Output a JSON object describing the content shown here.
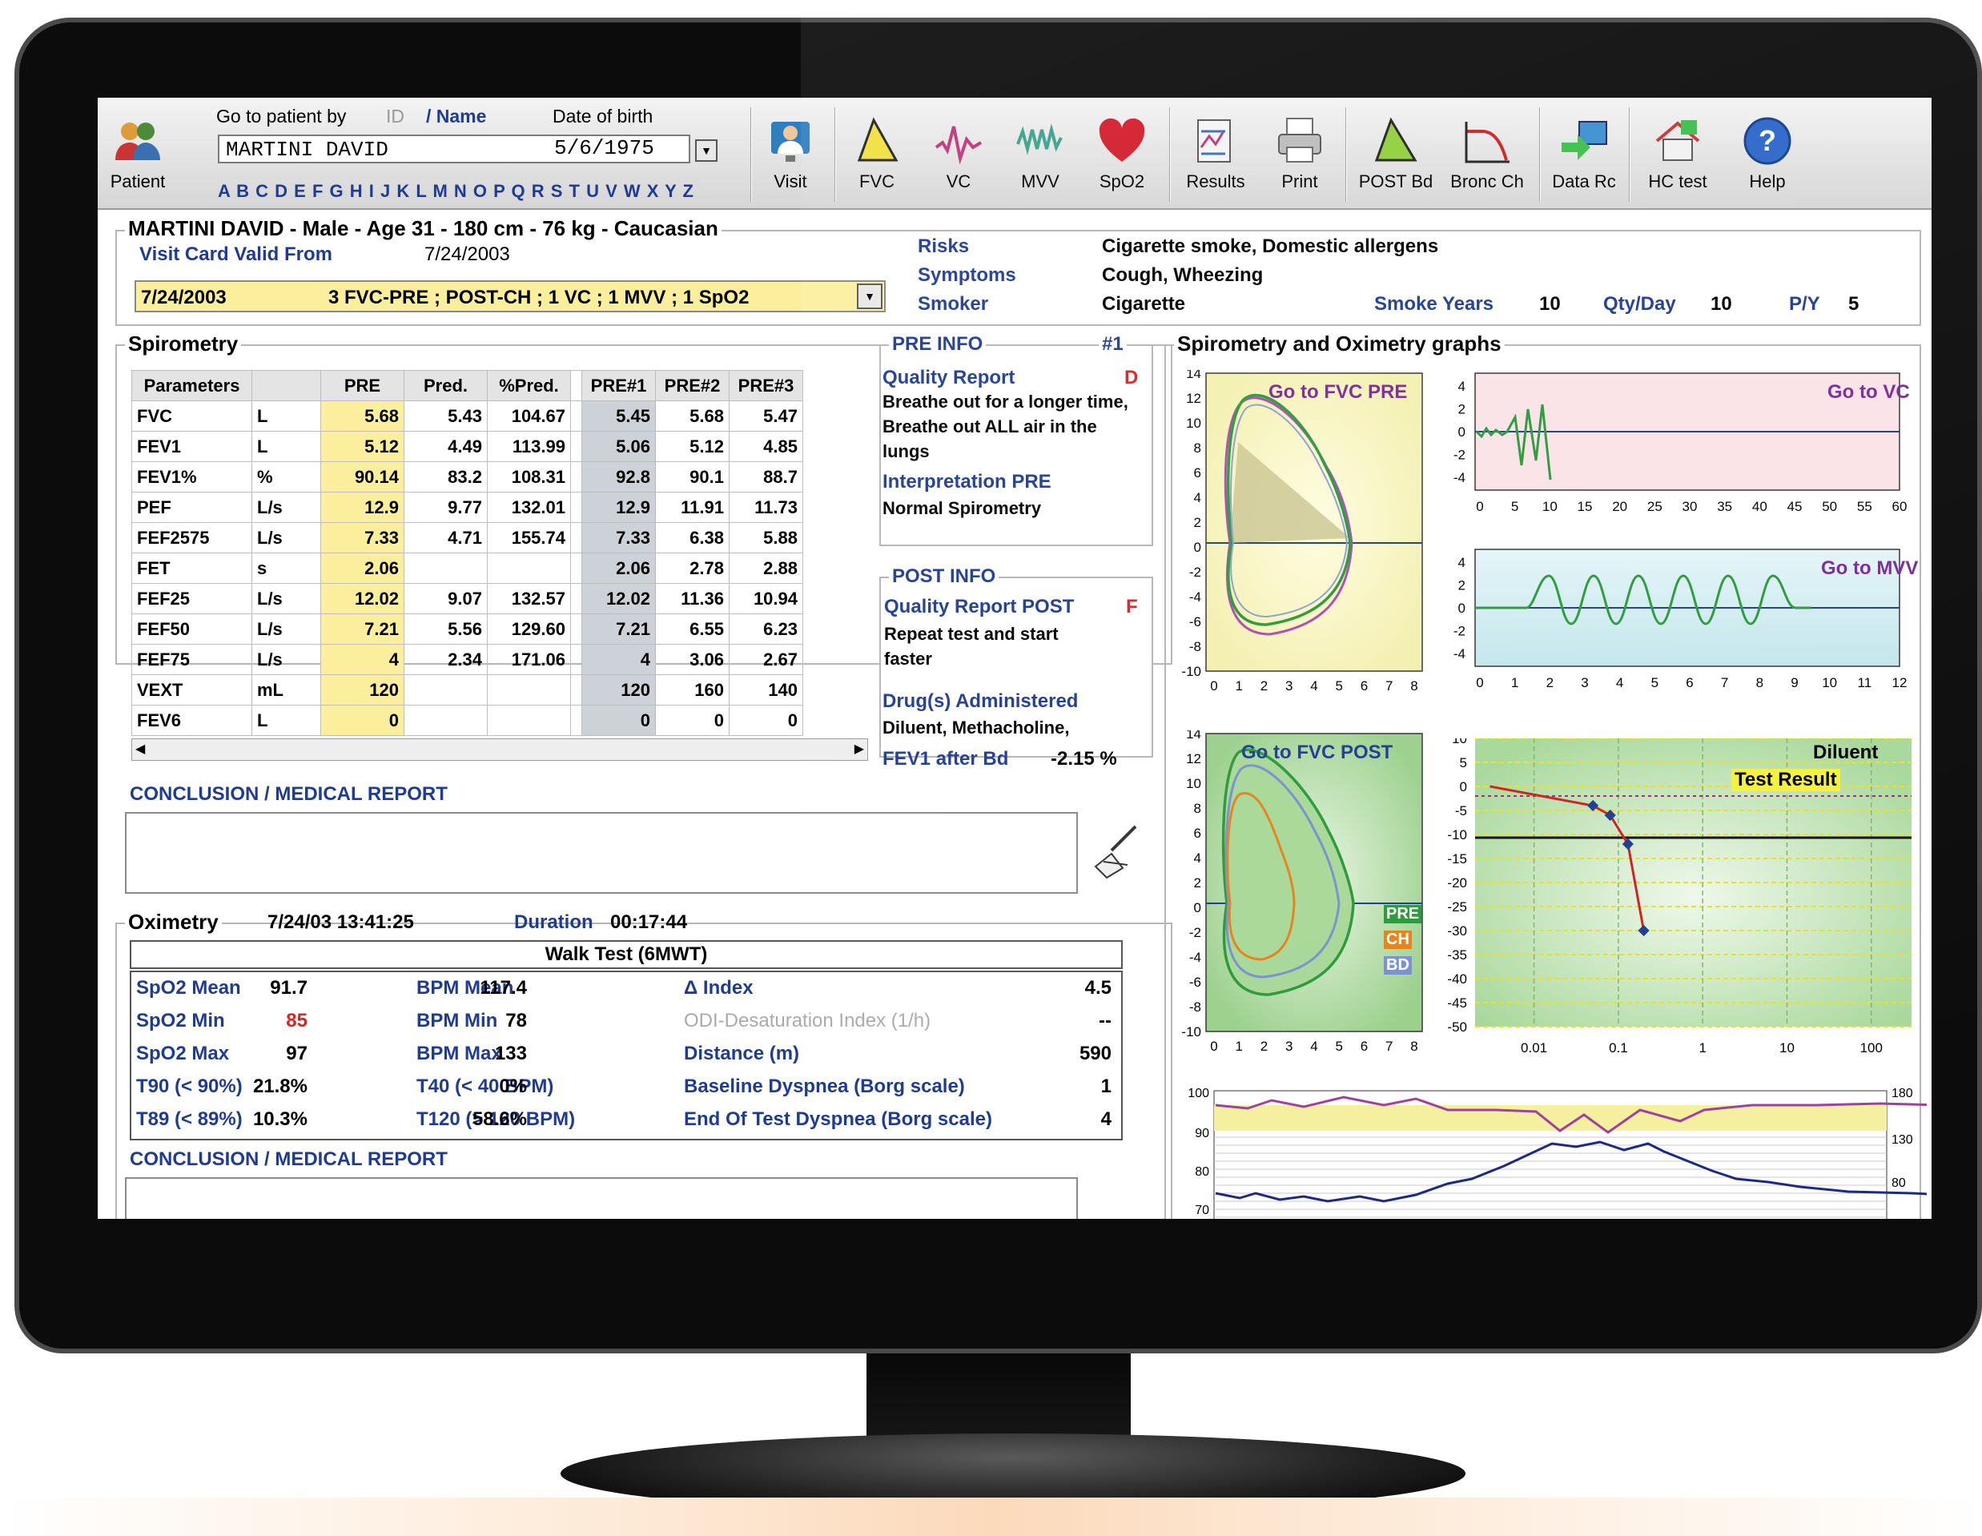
{
  "toolbar": {
    "patient_label": "Patient",
    "goto_label": "Go to patient by",
    "goto_id": "ID",
    "goto_name": "/ Name",
    "dob_label": "Date of birth",
    "patient_name": "MARTINI DAVID",
    "dob_value": "5/6/1975",
    "alphabet": "A B C D E F G H I J K L M N O P Q R S T U V W X Y Z",
    "buttons": [
      "Visit",
      "FVC",
      "VC",
      "MVV",
      "SpO2",
      "Results",
      "Print",
      "POST Bd",
      "Bronc Ch",
      "Data Rc",
      "HC test",
      "Help"
    ]
  },
  "patient": {
    "header": "MARTINI DAVID - Male - Age 31 - 180 cm - 76 kg - Caucasian",
    "visit_valid_label": "Visit Card Valid From",
    "visit_valid_date": "7/24/2003",
    "visit_select_date": "7/24/2003",
    "visit_select_tests": "3 FVC-PRE ; POST-CH ; 1 VC ; 1 MVV ; 1 SpO2",
    "risks_label": "Risks",
    "risks_value": "Cigarette smoke, Domestic allergens",
    "symptoms_label": "Symptoms",
    "symptoms_value": "Cough, Wheezing",
    "smoker_label": "Smoker",
    "smoker_value": "Cigarette",
    "smoke_years_label": "Smoke Years",
    "smoke_years_value": "10",
    "qty_label": "Qty/Day",
    "qty_value": "10",
    "py_label": "P/Y",
    "py_value": "5"
  },
  "spirometry": {
    "title": "Spirometry",
    "columns": [
      "Parameters",
      "",
      "PRE",
      "Pred.",
      "%Pred.",
      "",
      "PRE#1",
      "PRE#2",
      "PRE#3"
    ],
    "rows": [
      [
        "FVC",
        "L",
        "5.68",
        "5.43",
        "104.67",
        "5.45",
        "5.68",
        "5.47"
      ],
      [
        "FEV1",
        "L",
        "5.12",
        "4.49",
        "113.99",
        "5.06",
        "5.12",
        "4.85"
      ],
      [
        "FEV1%",
        "%",
        "90.14",
        "83.2",
        "108.31",
        "92.8",
        "90.1",
        "88.7"
      ],
      [
        "PEF",
        "L/s",
        "12.9",
        "9.77",
        "132.01",
        "12.9",
        "11.91",
        "11.73"
      ],
      [
        "FEF2575",
        "L/s",
        "7.33",
        "4.71",
        "155.74",
        "7.33",
        "6.38",
        "5.88"
      ],
      [
        "FET",
        "s",
        "2.06",
        "",
        "",
        "2.06",
        "2.78",
        "2.88"
      ],
      [
        "FEF25",
        "L/s",
        "12.02",
        "9.07",
        "132.57",
        "12.02",
        "11.36",
        "10.94"
      ],
      [
        "FEF50",
        "L/s",
        "7.21",
        "5.56",
        "129.60",
        "7.21",
        "6.55",
        "6.23"
      ],
      [
        "FEF75",
        "L/s",
        "4",
        "2.34",
        "171.06",
        "4",
        "3.06",
        "2.67"
      ],
      [
        "VEXT",
        "mL",
        "120",
        "",
        "",
        "120",
        "160",
        "140"
      ],
      [
        "FEV6",
        "L",
        "0",
        "",
        "",
        "0",
        "0",
        "0"
      ]
    ],
    "conclusion_label": "CONCLUSION / MEDICAL REPORT"
  },
  "pre_info": {
    "title": "PRE INFO",
    "number": "#1",
    "quality_label": "Quality Report",
    "quality_grade": "D",
    "quality_text": "Breathe out for a longer time, Breathe out ALL air in the lungs",
    "interp_label": "Interpretation PRE",
    "interp_text": "Normal Spirometry"
  },
  "post_info": {
    "title": "POST INFO",
    "quality_label": "Quality Report POST",
    "quality_grade": "F",
    "quality_text": "Repeat test and start faster",
    "drugs_label": "Drug(s) Administered",
    "drugs_text": "Diluent, Methacholine,",
    "fev1_label": "FEV1 after Bd",
    "fev1_value": "-2.15 %"
  },
  "oximetry": {
    "title": "Oximetry",
    "datetime": "7/24/03 13:41:25",
    "duration_label": "Duration",
    "duration_value": "00:17:44",
    "test_name": "Walk Test (6MWT)",
    "col1": [
      [
        "SpO2 Mean",
        "91.7"
      ],
      [
        "SpO2 Min",
        "85"
      ],
      [
        "SpO2 Max",
        "97"
      ],
      [
        "T90 (< 90%)",
        "21.8%"
      ],
      [
        "T89 (< 89%)",
        "10.3%"
      ]
    ],
    "col2": [
      [
        "BPM Mean",
        "117.4"
      ],
      [
        "BPM Min",
        "78"
      ],
      [
        "BPM Max",
        "133"
      ],
      [
        "T40 (< 40 BPM)",
        "0%"
      ],
      [
        "T120 (> 120 BPM)",
        "58.6%"
      ]
    ],
    "col3": [
      [
        "Δ Index",
        "4.5"
      ],
      [
        "ODI-Desaturation Index (1/h)",
        "--"
      ],
      [
        "Distance (m)",
        "590"
      ],
      [
        "Baseline Dyspnea (Borg scale)",
        "1"
      ],
      [
        "End Of Test Dyspnea (Borg scale)",
        "4"
      ]
    ],
    "conclusion_label": "CONCLUSION / MEDICAL REPORT"
  },
  "graphs": {
    "title": "Spirometry and Oximetry graphs",
    "fvc_pre_link": "Go to FVC PRE",
    "vc_link": "Go to VC",
    "mvv_link": "Go to MVV",
    "fvc_post_link": "Go to FVC POST",
    "legend_pre": "PRE",
    "legend_ch": "CH",
    "legend_bd": "BD",
    "bronc_label": "Diluent",
    "bronc_result": "Test Result"
  },
  "chart_data": [
    {
      "type": "line",
      "name": "FVC PRE flow-volume",
      "x_ticks": [
        "0",
        "1",
        "2",
        "3",
        "4",
        "5",
        "6",
        "7",
        "8"
      ],
      "y_ticks": [
        "14",
        "12",
        "10",
        "8",
        "6",
        "4",
        "2",
        "0",
        "-2",
        "-4",
        "-6",
        "-8",
        "-10"
      ],
      "xlim": [
        0,
        8
      ],
      "ylim": [
        -10,
        14
      ]
    },
    {
      "type": "line",
      "name": "VC",
      "x_ticks": [
        "0",
        "5",
        "10",
        "15",
        "20",
        "25",
        "30",
        "35",
        "40",
        "45",
        "50",
        "55",
        "60"
      ],
      "y_ticks": [
        "4",
        "2",
        "0",
        "-2",
        "-4"
      ],
      "xlim": [
        0,
        60
      ],
      "ylim": [
        -5,
        5
      ]
    },
    {
      "type": "line",
      "name": "MVV",
      "x_ticks": [
        "0",
        "1",
        "2",
        "3",
        "4",
        "5",
        "6",
        "7",
        "8",
        "9",
        "10",
        "11",
        "12"
      ],
      "y_ticks": [
        "4",
        "2",
        "0",
        "-2",
        "-4"
      ],
      "xlim": [
        0,
        12
      ],
      "ylim": [
        -5,
        5
      ]
    },
    {
      "type": "line",
      "name": "FVC POST flow-volume",
      "x_ticks": [
        "0",
        "1",
        "2",
        "3",
        "4",
        "5",
        "6",
        "7",
        "8"
      ],
      "y_ticks": [
        "14",
        "12",
        "10",
        "8",
        "6",
        "4",
        "2",
        "0",
        "-2",
        "-4",
        "-6",
        "-8",
        "-10"
      ],
      "xlim": [
        0,
        8
      ],
      "ylim": [
        -10,
        14
      ]
    },
    {
      "type": "line",
      "name": "Bronchial challenge",
      "x_ticks": [
        "0.01",
        "0.1",
        "1",
        "10",
        "100"
      ],
      "y_ticks": [
        "10",
        "5",
        "0",
        "-5",
        "-10",
        "-15",
        "-20",
        "-25",
        "-30",
        "-35",
        "-40",
        "-45",
        "-50"
      ],
      "points": [
        {
          "x": 0.003,
          "y": 0
        },
        {
          "x": 0.05,
          "y": -4
        },
        {
          "x": 0.08,
          "y": -6
        },
        {
          "x": 0.13,
          "y": -12
        },
        {
          "x": 0.2,
          "y": -30
        }
      ],
      "ylim": [
        -50,
        10
      ],
      "x_scale": "log"
    },
    {
      "type": "line",
      "name": "Oximetry trend",
      "left_ticks": [
        "100",
        "90",
        "80",
        "70"
      ],
      "right_ticks": [
        "180",
        "130",
        "80"
      ]
    }
  ]
}
